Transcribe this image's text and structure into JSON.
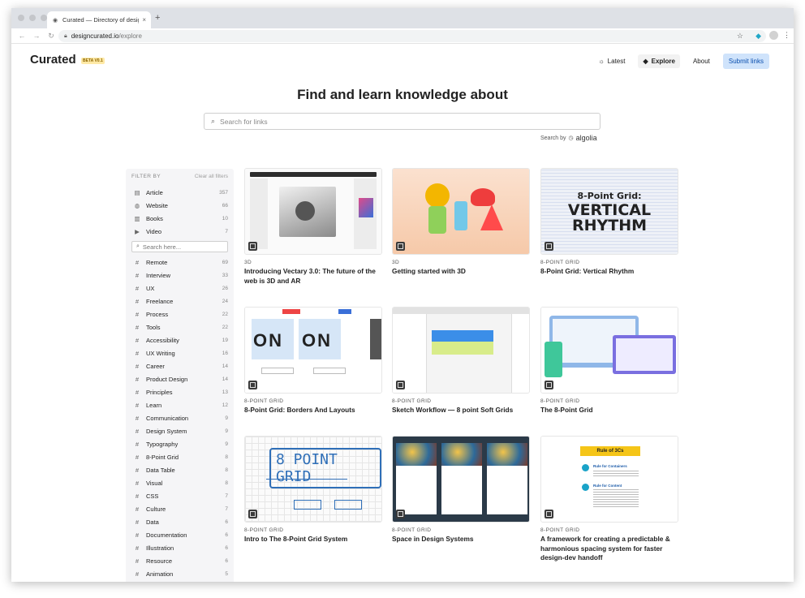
{
  "browser": {
    "tab_title": "Curated — Directory of design",
    "tab_close": "×",
    "new_tab": "+",
    "url_host": "designcurated.io",
    "url_path": "/explore",
    "back": "←",
    "forward": "→",
    "reload": "↻",
    "star": "☆",
    "kebab": "⋮"
  },
  "header": {
    "logo": "Curated",
    "beta": "BETA V0.1",
    "nav": {
      "latest": "Latest",
      "explore": "Explore",
      "about": "About",
      "submit": "Submit links"
    },
    "icons": {
      "latest": "sun-icon",
      "explore": "compass-icon"
    }
  },
  "hero": {
    "title": "Find and learn knowledge about",
    "search_placeholder": "Search for links",
    "search_by": "Search by",
    "algolia": "algolia"
  },
  "sidebar": {
    "filter_by": "FILTER BY",
    "clear": "Clear all filters",
    "types": [
      {
        "label": "Article",
        "count": "357",
        "icon": "document-icon"
      },
      {
        "label": "Website",
        "count": "66",
        "icon": "globe-icon"
      },
      {
        "label": "Books",
        "count": "10",
        "icon": "book-icon"
      },
      {
        "label": "Video",
        "count": "7",
        "icon": "video-icon"
      }
    ],
    "search_placeholder": "Search here...",
    "tags": [
      {
        "label": "Remote",
        "count": "69"
      },
      {
        "label": "Interview",
        "count": "33"
      },
      {
        "label": "UX",
        "count": "26"
      },
      {
        "label": "Freelance",
        "count": "24"
      },
      {
        "label": "Process",
        "count": "22"
      },
      {
        "label": "Tools",
        "count": "22"
      },
      {
        "label": "Accessibility",
        "count": "19"
      },
      {
        "label": "UX Writing",
        "count": "16"
      },
      {
        "label": "Career",
        "count": "14"
      },
      {
        "label": "Product Design",
        "count": "14"
      },
      {
        "label": "Principles",
        "count": "13"
      },
      {
        "label": "Learn",
        "count": "12"
      },
      {
        "label": "Communication",
        "count": "9"
      },
      {
        "label": "Design System",
        "count": "9"
      },
      {
        "label": "Typography",
        "count": "9"
      },
      {
        "label": "8-Point Grid",
        "count": "8"
      },
      {
        "label": "Data Table",
        "count": "8"
      },
      {
        "label": "Visual",
        "count": "8"
      },
      {
        "label": "CSS",
        "count": "7"
      },
      {
        "label": "Culture",
        "count": "7"
      },
      {
        "label": "Data",
        "count": "6"
      },
      {
        "label": "Documentation",
        "count": "6"
      },
      {
        "label": "Illustration",
        "count": "6"
      },
      {
        "label": "Resource",
        "count": "6"
      },
      {
        "label": "Animation",
        "count": "5"
      }
    ]
  },
  "cards": [
    {
      "category": "3D",
      "title": "Introducing Vectary 3.0: The future of the web is 3D and AR"
    },
    {
      "category": "3D",
      "title": "Getting started with 3D"
    },
    {
      "category": "8-Point Grid",
      "title": "8-Point Grid: Vertical Rhythm",
      "thumb_text": [
        "8-Point Grid:",
        "VERTICAL",
        "RHYTHM"
      ]
    },
    {
      "category": "8-Point Grid",
      "title": "8-Point Grid: Borders And Layouts"
    },
    {
      "category": "8-Point Grid",
      "title": "Sketch Workflow — 8 point Soft Grids"
    },
    {
      "category": "8-Point Grid",
      "title": "The 8-Point Grid"
    },
    {
      "category": "8-Point Grid",
      "title": "Intro to The 8-Point Grid System",
      "thumb_text": [
        "8 POINT GRID"
      ]
    },
    {
      "category": "8-Point Grid",
      "title": "Space in Design Systems"
    },
    {
      "category": "8-Point Grid",
      "title": "A framework for creating a predictable & harmonious spacing system for faster design-dev handoff",
      "thumb_text": [
        "Rule of 3Cs",
        "Rule for Containers",
        "Rule for Content"
      ]
    }
  ],
  "colors": {
    "accent": "#cfe3fb",
    "accent_text": "#0a4fae",
    "beta_bg": "#ffe9a6"
  }
}
